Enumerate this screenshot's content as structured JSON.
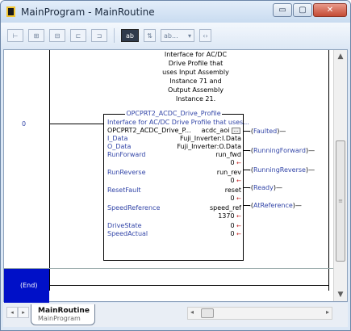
{
  "window": {
    "title": "MainProgram - MainRoutine",
    "min_glyph": "▭",
    "max_glyph": "▢",
    "close_glyph": "✕"
  },
  "toolbar": {
    "zoom_label": "ab..."
  },
  "rung": {
    "number": "0",
    "comment": [
      "Interface for AC/DC",
      "Drive Profile that",
      "uses Input Assembly",
      "Instance 71 and",
      "Output Assembly",
      "Instance 21."
    ]
  },
  "aoi": {
    "title": "OPCPRT2_ACDC_Drive_Profile",
    "description": "Interface for AC/DC Drive Profile that uses...",
    "instance_type": "OPCPRT2_ACDC_Drive_P...",
    "instance_tag": "acdc_aoi",
    "params": [
      {
        "name": "I_Data",
        "tag": "Fuji_Inverter:I.Data",
        "value": ""
      },
      {
        "name": "O_Data",
        "tag": "Fuji_Inverter:O.Data",
        "value": ""
      },
      {
        "name": "RunForward",
        "tag": "run_fwd",
        "value": "0"
      },
      {
        "name": "RunReverse",
        "tag": "run_rev",
        "value": "0"
      },
      {
        "name": "ResetFault",
        "tag": "reset",
        "value": "0"
      },
      {
        "name": "SpeedReference",
        "tag": "speed_ref",
        "value": "1370"
      },
      {
        "name": "DriveState",
        "tag": "",
        "value": "0"
      },
      {
        "name": "SpeedActual",
        "tag": "",
        "value": "0"
      }
    ]
  },
  "coils": [
    {
      "open": "-(",
      "name": "Faulted",
      "close": ")—"
    },
    {
      "open": "-(",
      "name": "RunningForward",
      "close": ")—"
    },
    {
      "open": "-(",
      "name": "RunningReverse",
      "close": ")—"
    },
    {
      "open": "-(",
      "name": "Ready",
      "close": ")—"
    },
    {
      "open": "-(",
      "name": "AtReference",
      "close": ")—"
    }
  ],
  "end_label": "(End)",
  "tabs": [
    {
      "title": "MainRoutine",
      "subtitle": "MainProgram"
    }
  ],
  "colors": {
    "tag_blue": "#3346a8",
    "end_block": "#0010c8",
    "value_arrow_red": "#c22020"
  }
}
